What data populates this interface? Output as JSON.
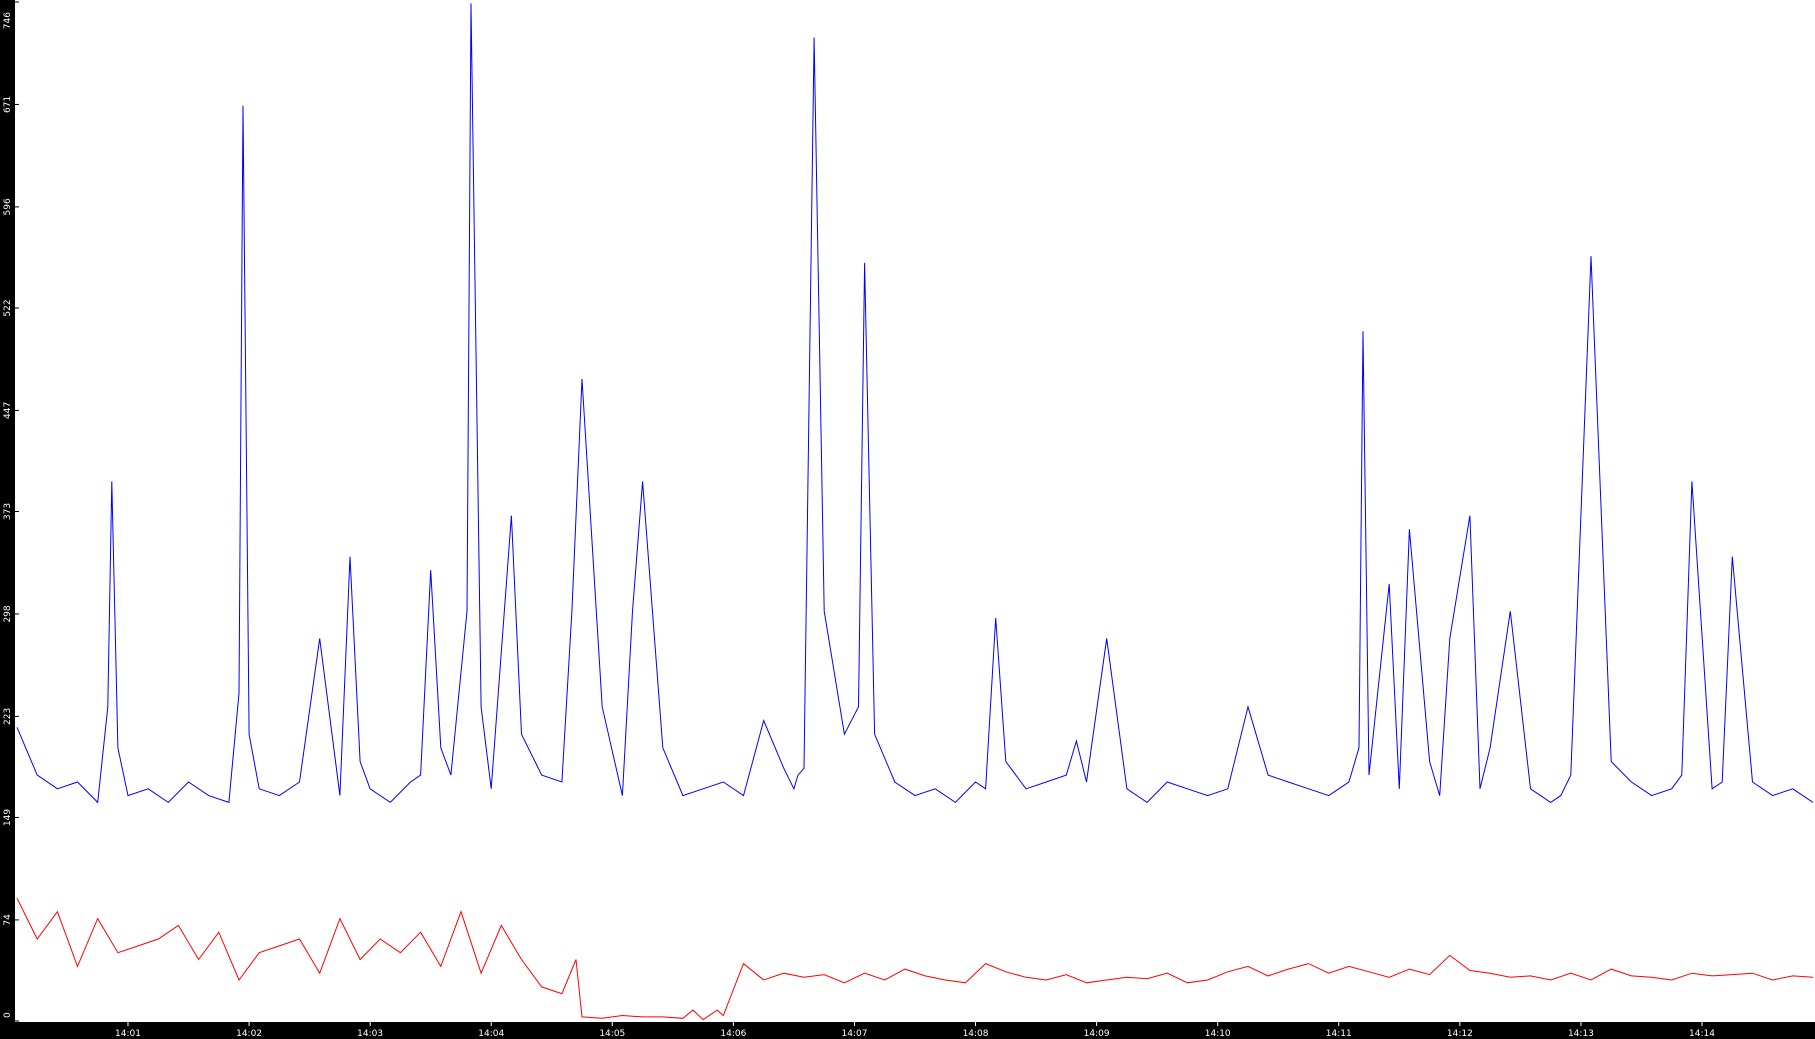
{
  "chart_data": {
    "type": "line",
    "title": "",
    "xlabel": "",
    "ylabel": "",
    "ylim": [
      0,
      746
    ],
    "y_ticks": [
      0,
      74,
      149,
      223,
      298,
      373,
      447,
      522,
      596,
      671,
      746
    ],
    "x_ticks": [
      "14:01",
      "14:02",
      "14:03",
      "14:04",
      "14:05",
      "14:06",
      "14:07",
      "14:08",
      "14:09",
      "14:10",
      "14:11",
      "14:12",
      "14:13",
      "14:14"
    ],
    "x_range": [
      "14:00:05",
      "14:14:55"
    ],
    "grid": false,
    "legend": "none",
    "colors": {
      "axis_bar": "#000000",
      "tick_label": "#ffffff",
      "series_a": "#0000ff",
      "series_b": "#ff0000",
      "background": "#ffffff"
    },
    "series": [
      {
        "color": "#0000ff",
        "x": [
          "14:00:05",
          "14:00:15",
          "14:00:25",
          "14:00:35",
          "14:00:45",
          "14:00:50",
          "14:00:52",
          "14:00:55",
          "14:01:00",
          "14:01:10",
          "14:01:20",
          "14:01:30",
          "14:01:40",
          "14:01:50",
          "14:01:55",
          "14:01:57",
          "14:02:00",
          "14:02:05",
          "14:02:15",
          "14:02:25",
          "14:02:35",
          "14:02:45",
          "14:02:50",
          "14:02:55",
          "14:03:00",
          "14:03:10",
          "14:03:20",
          "14:03:25",
          "14:03:30",
          "14:03:35",
          "14:03:40",
          "14:03:48",
          "14:03:50",
          "14:03:55",
          "14:04:00",
          "14:04:10",
          "14:04:15",
          "14:04:25",
          "14:04:35",
          "14:04:40",
          "14:04:45",
          "14:04:55",
          "14:05:05",
          "14:05:10",
          "14:05:15",
          "14:05:25",
          "14:05:35",
          "14:05:45",
          "14:05:55",
          "14:06:05",
          "14:06:15",
          "14:06:25",
          "14:06:30",
          "14:06:32",
          "14:06:35",
          "14:06:40",
          "14:06:45",
          "14:06:55",
          "14:07:02",
          "14:07:05",
          "14:07:10",
          "14:07:20",
          "14:07:30",
          "14:07:40",
          "14:07:50",
          "14:08:00",
          "14:08:05",
          "14:08:10",
          "14:08:15",
          "14:08:25",
          "14:08:35",
          "14:08:45",
          "14:08:50",
          "14:08:55",
          "14:09:05",
          "14:09:15",
          "14:09:25",
          "14:09:35",
          "14:09:45",
          "14:09:55",
          "14:10:05",
          "14:10:15",
          "14:10:25",
          "14:10:35",
          "14:10:45",
          "14:10:55",
          "14:11:05",
          "14:11:10",
          "14:11:12",
          "14:11:15",
          "14:11:25",
          "14:11:30",
          "14:11:35",
          "14:11:45",
          "14:11:50",
          "14:11:55",
          "14:12:05",
          "14:12:10",
          "14:12:15",
          "14:12:25",
          "14:12:35",
          "14:12:45",
          "14:12:50",
          "14:12:55",
          "14:13:05",
          "14:13:15",
          "14:13:25",
          "14:13:35",
          "14:13:45",
          "14:13:50",
          "14:13:55",
          "14:14:05",
          "14:14:10",
          "14:14:15",
          "14:14:25",
          "14:14:35",
          "14:14:45",
          "14:14:55"
        ],
        "values": [
          215,
          180,
          170,
          175,
          160,
          230,
          395,
          200,
          165,
          170,
          160,
          175,
          165,
          160,
          240,
          670,
          210,
          170,
          165,
          175,
          280,
          165,
          340,
          190,
          170,
          160,
          175,
          180,
          330,
          200,
          180,
          300,
          745,
          230,
          170,
          370,
          210,
          180,
          175,
          300,
          470,
          230,
          165,
          300,
          395,
          200,
          165,
          170,
          175,
          165,
          220,
          185,
          170,
          180,
          185,
          720,
          300,
          210,
          230,
          555,
          210,
          175,
          165,
          170,
          160,
          175,
          170,
          295,
          190,
          170,
          175,
          180,
          205,
          175,
          280,
          170,
          160,
          175,
          170,
          165,
          170,
          230,
          180,
          175,
          170,
          165,
          175,
          200,
          505,
          180,
          320,
          170,
          360,
          190,
          165,
          280,
          370,
          170,
          200,
          300,
          170,
          160,
          165,
          180,
          560,
          190,
          175,
          165,
          170,
          180,
          395,
          170,
          175,
          340,
          175,
          165,
          170,
          160
        ]
      },
      {
        "color": "#ff0000",
        "x": [
          "14:00:05",
          "14:00:15",
          "14:00:25",
          "14:00:35",
          "14:00:45",
          "14:00:55",
          "14:01:05",
          "14:01:15",
          "14:01:25",
          "14:01:35",
          "14:01:45",
          "14:01:55",
          "14:02:05",
          "14:02:15",
          "14:02:25",
          "14:02:35",
          "14:02:45",
          "14:02:55",
          "14:03:05",
          "14:03:15",
          "14:03:25",
          "14:03:35",
          "14:03:45",
          "14:03:55",
          "14:04:05",
          "14:04:15",
          "14:04:25",
          "14:04:35",
          "14:04:42",
          "14:04:45",
          "14:04:55",
          "14:05:05",
          "14:05:15",
          "14:05:25",
          "14:05:35",
          "14:05:40",
          "14:05:45",
          "14:05:52",
          "14:05:55",
          "14:06:05",
          "14:06:15",
          "14:06:25",
          "14:06:35",
          "14:06:45",
          "14:06:55",
          "14:07:05",
          "14:07:15",
          "14:07:25",
          "14:07:35",
          "14:07:45",
          "14:07:55",
          "14:08:05",
          "14:08:15",
          "14:08:25",
          "14:08:35",
          "14:08:45",
          "14:08:55",
          "14:09:05",
          "14:09:15",
          "14:09:25",
          "14:09:35",
          "14:09:45",
          "14:09:55",
          "14:10:05",
          "14:10:15",
          "14:10:25",
          "14:10:35",
          "14:10:45",
          "14:10:55",
          "14:11:05",
          "14:11:15",
          "14:11:25",
          "14:11:35",
          "14:11:45",
          "14:11:55",
          "14:12:05",
          "14:12:15",
          "14:12:25",
          "14:12:35",
          "14:12:45",
          "14:12:55",
          "14:13:05",
          "14:13:15",
          "14:13:25",
          "14:13:35",
          "14:13:45",
          "14:13:55",
          "14:14:05",
          "14:14:15",
          "14:14:25",
          "14:14:35",
          "14:14:45",
          "14:14:55"
        ],
        "values": [
          90,
          60,
          80,
          40,
          75,
          50,
          55,
          60,
          70,
          45,
          65,
          30,
          50,
          55,
          60,
          35,
          75,
          45,
          60,
          50,
          65,
          40,
          80,
          35,
          70,
          45,
          25,
          20,
          45,
          3,
          2,
          4,
          3,
          3,
          2,
          8,
          1,
          8,
          4,
          42,
          30,
          35,
          32,
          34,
          28,
          35,
          30,
          38,
          33,
          30,
          28,
          42,
          36,
          32,
          30,
          34,
          28,
          30,
          32,
          31,
          35,
          28,
          30,
          36,
          40,
          33,
          38,
          42,
          35,
          40,
          36,
          32,
          38,
          34,
          48,
          37,
          35,
          32,
          33,
          30,
          35,
          30,
          38,
          33,
          32,
          30,
          35,
          33,
          34,
          35,
          30,
          33,
          32
        ]
      }
    ]
  }
}
